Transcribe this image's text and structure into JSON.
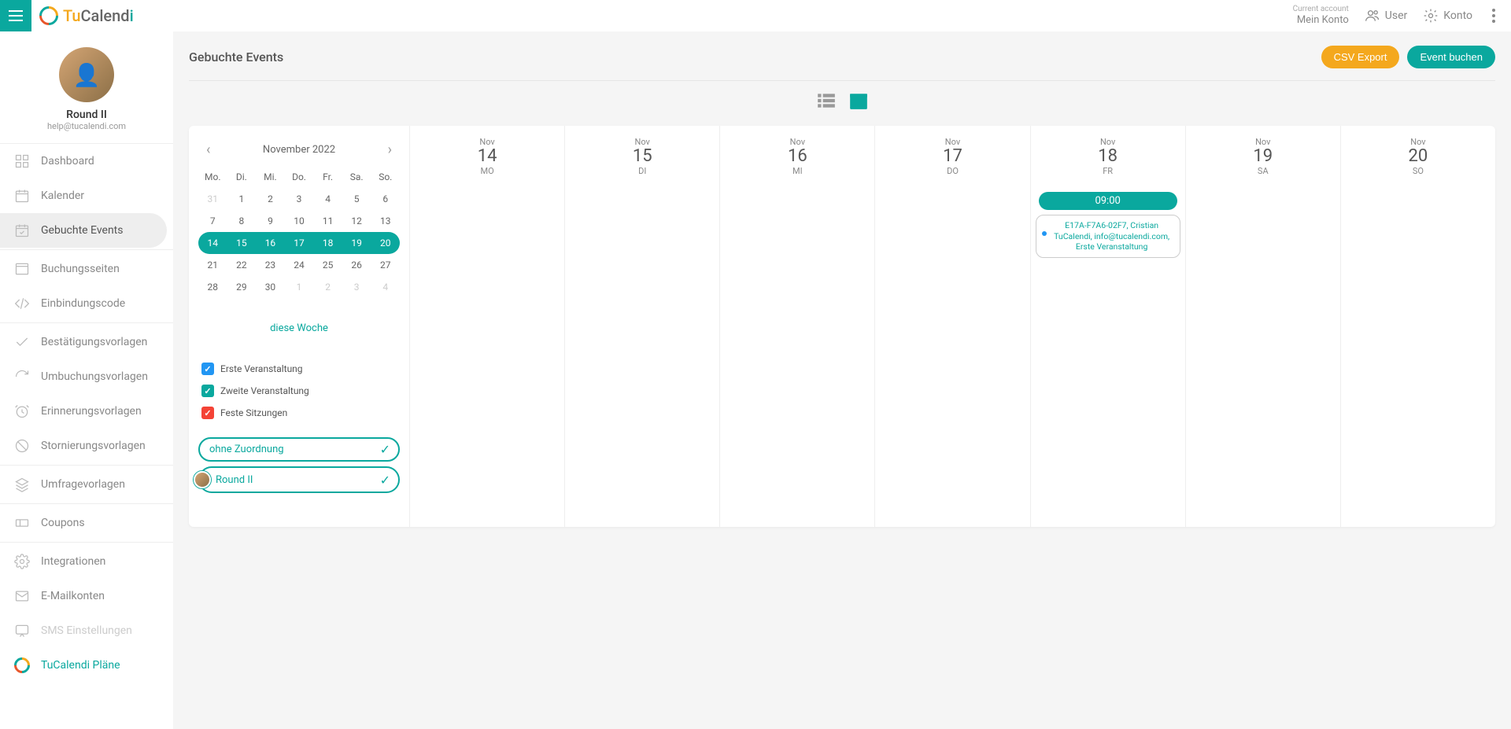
{
  "topbar": {
    "brand": {
      "tu": "Tu",
      "calend": "Calend",
      "i": "i"
    },
    "current_account_label": "Current account",
    "current_account_value": "Mein Konto",
    "user_label": "User",
    "konto_label": "Konto"
  },
  "profile": {
    "name": "Round II",
    "email": "help@tucalendi.com"
  },
  "nav": {
    "dashboard": "Dashboard",
    "kalender": "Kalender",
    "gebuchte": "Gebuchte Events",
    "buchungsseiten": "Buchungsseiten",
    "einbindungscode": "Einbindungscode",
    "bestatigungs": "Bestätigungsvorlagen",
    "umbuchungs": "Umbuchungsvorlagen",
    "erinnerungs": "Erinnerungsvorlagen",
    "stornierungs": "Stornierungsvorlagen",
    "umfrage": "Umfragevorlagen",
    "coupons": "Coupons",
    "integrationen": "Integrationen",
    "emailkonten": "E-Mailkonten",
    "sms": "SMS Einstellungen",
    "plane": "TuCalendi Pläne"
  },
  "page": {
    "title": "Gebuchte Events",
    "csv_export": "CSV Export",
    "event_buchen": "Event buchen"
  },
  "minical": {
    "title": "November 2022",
    "dow": [
      "Mo.",
      "Di.",
      "Mi.",
      "Do.",
      "Fr.",
      "Sa.",
      "So."
    ],
    "weeks": [
      {
        "days": [
          "31",
          "1",
          "2",
          "3",
          "4",
          "5",
          "6"
        ],
        "muted": [
          true,
          false,
          false,
          false,
          false,
          false,
          false
        ]
      },
      {
        "days": [
          "7",
          "8",
          "9",
          "10",
          "11",
          "12",
          "13"
        ],
        "muted": [
          false,
          false,
          false,
          false,
          false,
          false,
          false
        ]
      },
      {
        "days": [
          "14",
          "15",
          "16",
          "17",
          "18",
          "19",
          "20"
        ],
        "muted": [
          false,
          false,
          false,
          false,
          false,
          false,
          false
        ],
        "selected": true
      },
      {
        "days": [
          "21",
          "22",
          "23",
          "24",
          "25",
          "26",
          "27"
        ],
        "muted": [
          false,
          false,
          false,
          false,
          false,
          false,
          false
        ]
      },
      {
        "days": [
          "28",
          "29",
          "30",
          "1",
          "2",
          "3",
          "4"
        ],
        "muted": [
          false,
          false,
          false,
          true,
          true,
          true,
          true
        ]
      }
    ],
    "this_week": "diese Woche"
  },
  "filters": {
    "event_types": [
      {
        "label": "Erste Veranstaltung",
        "color": "blue"
      },
      {
        "label": "Zweite Veranstaltung",
        "color": "teal"
      },
      {
        "label": "Feste Sitzungen",
        "color": "red"
      }
    ],
    "assignees": [
      {
        "label": "ohne Zuordnung",
        "has_avatar": false
      },
      {
        "label": "Round II",
        "has_avatar": true
      }
    ]
  },
  "week": {
    "month_short": "Nov",
    "days": [
      {
        "num": "14",
        "dow": "MO"
      },
      {
        "num": "15",
        "dow": "DI"
      },
      {
        "num": "16",
        "dow": "MI"
      },
      {
        "num": "17",
        "dow": "DO"
      },
      {
        "num": "18",
        "dow": "FR"
      },
      {
        "num": "19",
        "dow": "SA"
      },
      {
        "num": "20",
        "dow": "SO"
      }
    ],
    "event": {
      "day_index": 4,
      "time": "09:00",
      "text": "E17A-F7A6-02F7, Cristian TuCalendi, info@tucalendi.com, Erste Veranstaltung"
    }
  }
}
